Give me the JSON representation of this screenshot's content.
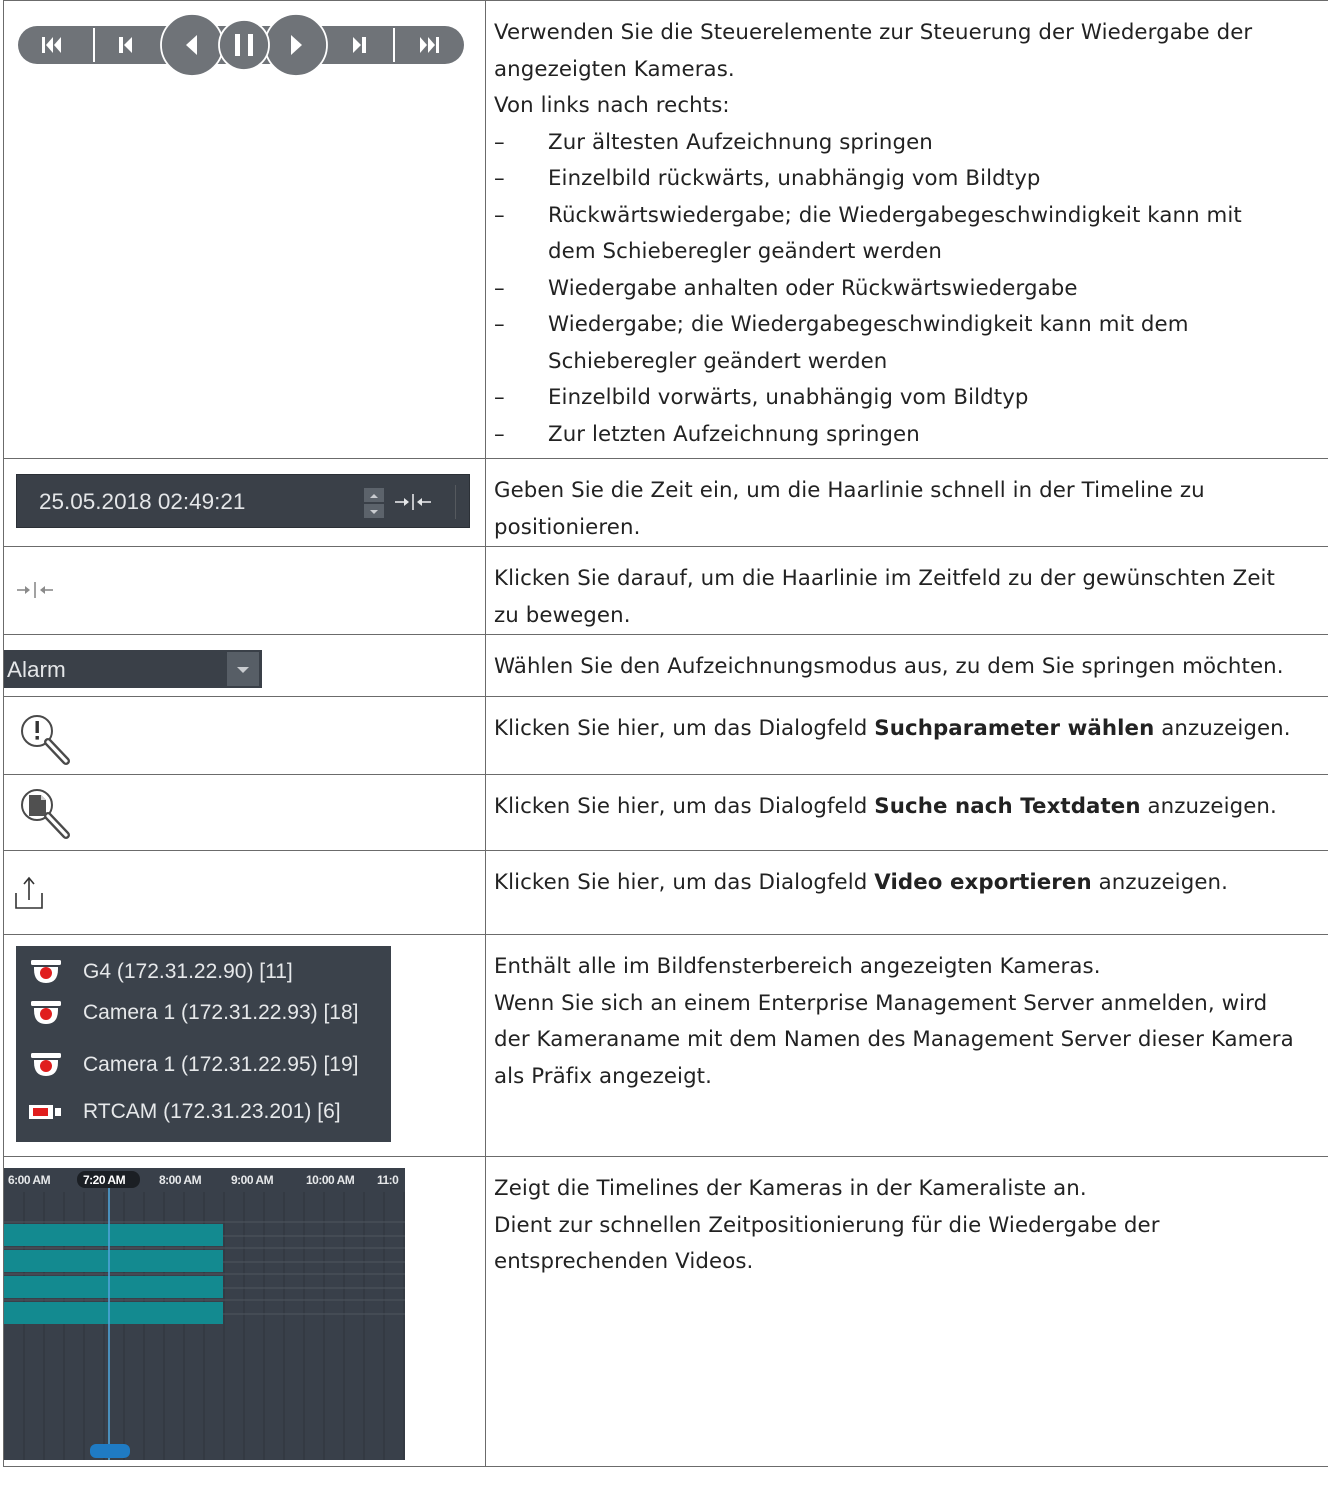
{
  "rows": {
    "playback": {
      "intro": [
        "Verwenden Sie die Steuerelemente zur Steuerung der Wiedergabe der",
        "angezeigten Kameras.",
        "Von links nach rechts:"
      ],
      "items": [
        [
          "Zur ältesten Aufzeichnung springen"
        ],
        [
          "Einzelbild rückwärts, unabhängig vom Bildtyp"
        ],
        [
          "Rückwärtswiedergabe; die Wiedergabegeschwindigkeit kann mit",
          "dem Schieberegler geändert werden"
        ],
        [
          "Wiedergabe anhalten oder Rückwärtswiedergabe"
        ],
        [
          "Wiedergabe; die Wiedergabegeschwindigkeit kann mit dem",
          "Schieberegler geändert werden"
        ],
        [
          "Einzelbild vorwärts, unabhängig vom Bildtyp"
        ],
        [
          "Zur letzten Aufzeichnung springen"
        ]
      ],
      "dash": "–"
    },
    "timefield": {
      "value": "25.05.2018 02:49:21",
      "lines": [
        "Geben Sie die Zeit ein, um die Haarlinie schnell in der Timeline zu",
        "positionieren."
      ]
    },
    "jump": {
      "lines": [
        "Klicken Sie darauf, um die Haarlinie im Zeitfeld zu der gewünschten Zeit",
        "zu bewegen."
      ]
    },
    "mode": {
      "selected": "Alarm",
      "text": "Wählen Sie den Aufzeichnungsmodus aus, zu dem Sie springen möchten."
    },
    "search_params": {
      "before": "Klicken Sie hier, um das Dialogfeld ",
      "bold": "Suchparameter wählen",
      "after": " anzuzeigen."
    },
    "text_search": {
      "before": "Klicken Sie hier, um das Dialogfeld ",
      "bold": "Suche nach Textdaten",
      "after": " anzuzeigen."
    },
    "export": {
      "before": "Klicken Sie hier, um das Dialogfeld ",
      "bold": "Video exportieren",
      "after": " anzuzeigen."
    },
    "cameras": {
      "list": [
        {
          "label": "G4 (172.31.22.90) [11]",
          "icon": "dome-camera-icon"
        },
        {
          "label": "Camera 1 (172.31.22.93) [18]",
          "icon": "dome-camera-icon"
        },
        {
          "label": "Camera 1 (172.31.22.95) [19]",
          "icon": "dome-camera-icon"
        },
        {
          "label": "RTCAM (172.31.23.201) [6]",
          "icon": "box-camera-icon"
        }
      ],
      "lines": [
        "Enthält alle im Bildfensterbereich angezeigten Kameras.",
        "Wenn Sie sich an einem Enterprise Management Server anmelden, wird",
        "der Kameraname mit dem Namen des Management Server dieser Kamera",
        "als Präfix angezeigt."
      ]
    },
    "timeline": {
      "ticks": [
        "6:00 AM",
        "7:20 AM",
        "8:00 AM",
        "9:00 AM",
        "10:00 AM",
        "11:0"
      ],
      "current": "7:20 AM",
      "lines": [
        "Zeigt die Timelines der Kameras in der Kameraliste an.",
        "Dient zur schnellen Zeitpositionierung für die Wiedergabe der",
        "entsprechenden Videos."
      ]
    }
  },
  "colors": {
    "control_bg": "#3a4048",
    "button": "#6f7378",
    "recording": "#138a90",
    "hairline": "#4ea3d8",
    "camera_red": "#e01e1e"
  }
}
